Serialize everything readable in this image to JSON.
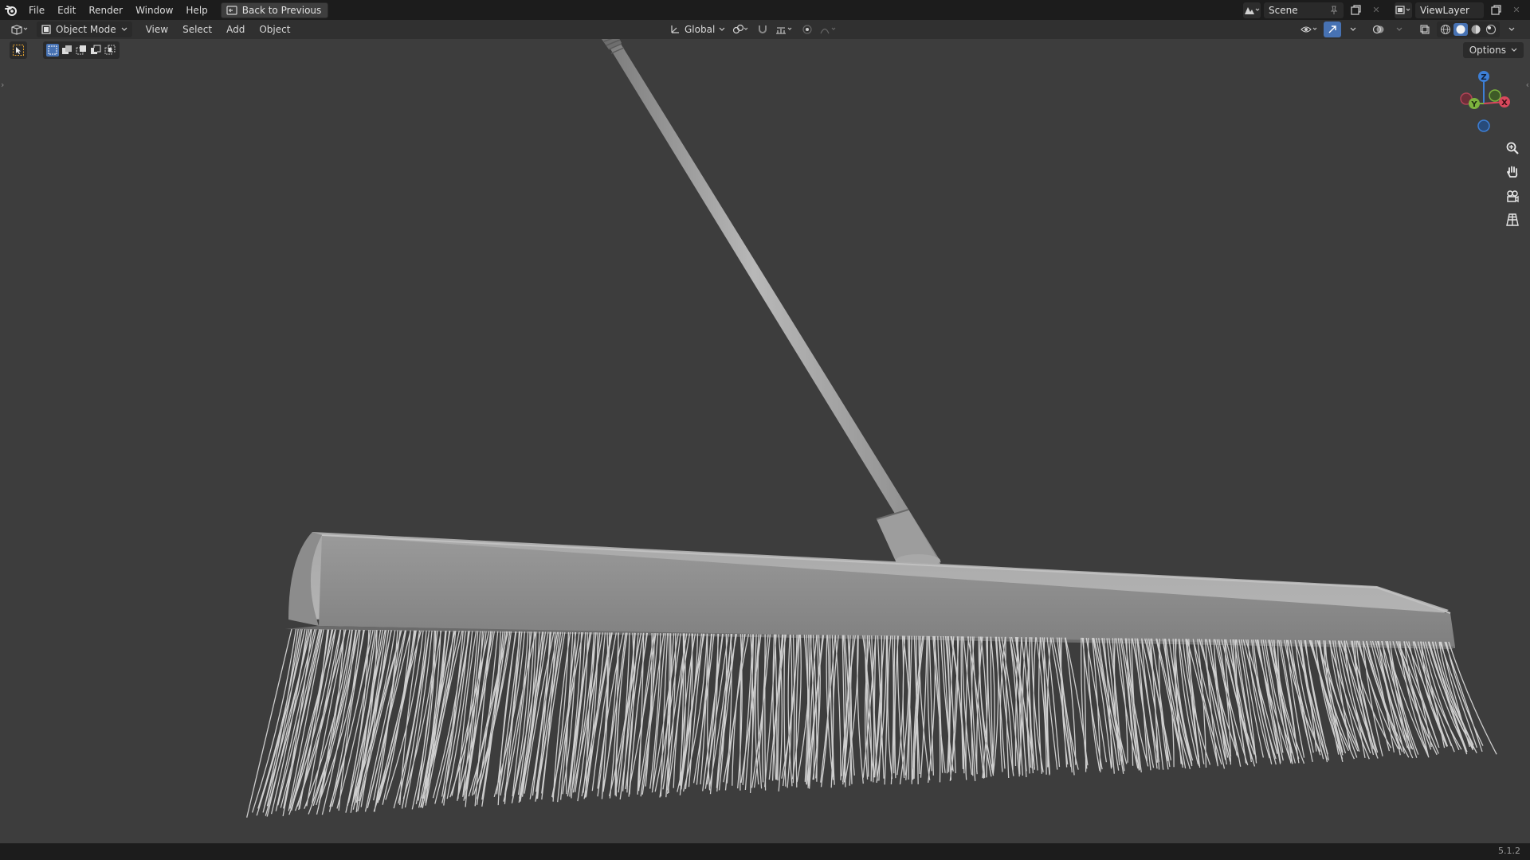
{
  "topbar": {
    "menus": [
      "File",
      "Edit",
      "Render",
      "Window",
      "Help"
    ],
    "back_label": "Back to Previous",
    "scene_name": "Scene",
    "view_layer": "ViewLayer"
  },
  "header": {
    "mode": "Object Mode",
    "menus": [
      "View",
      "Select",
      "Add",
      "Object"
    ],
    "orientation": "Global"
  },
  "options_label": "Options",
  "version": "5.1.2",
  "gizmo": {
    "axes": [
      "Z",
      "Y",
      "X"
    ],
    "colors": {
      "x": "#d8485c",
      "y": "#7cb33e",
      "z": "#3d7fd6"
    }
  },
  "colors": {
    "viewport_bg": "#3d3d3d",
    "topbar_bg": "#1c1c1c",
    "accent": "#4772b3"
  }
}
